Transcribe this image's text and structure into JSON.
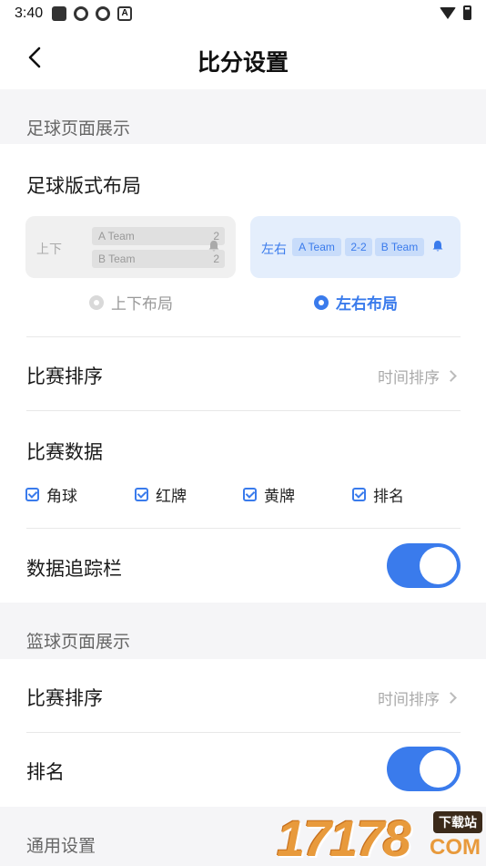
{
  "status_bar": {
    "time": "3:40"
  },
  "header": {
    "title": "比分设置"
  },
  "football": {
    "section_label": "足球页面展示",
    "layout_title": "足球版式布局",
    "card_left": {
      "side_label": "上下",
      "team_a": "A Team",
      "team_a_score": "2",
      "team_b": "B Team",
      "team_b_score": "2"
    },
    "card_right": {
      "side_label": "左右",
      "team_a": "A Team",
      "score": "2-2",
      "team_b": "B Team"
    },
    "option_left": "上下布局",
    "option_right": "左右布局",
    "selected_option": "左右布局",
    "sort_label": "比赛排序",
    "sort_value": "时间排序",
    "data_label": "比赛数据",
    "data_options": [
      "角球",
      "红牌",
      "黄牌",
      "排名"
    ],
    "tracker_label": "数据追踪栏",
    "tracker_on": true
  },
  "basketball": {
    "section_label": "篮球页面展示",
    "sort_label": "比赛排序",
    "sort_value": "时间排序",
    "rank_label": "排名",
    "rank_on": true
  },
  "general": {
    "section_label": "通用设置"
  },
  "watermark": {
    "number": "17178",
    "tag": "下载站",
    "domain": "COM"
  },
  "colors": {
    "accent": "#3a7bec",
    "section_bg": "#f5f5f7"
  }
}
